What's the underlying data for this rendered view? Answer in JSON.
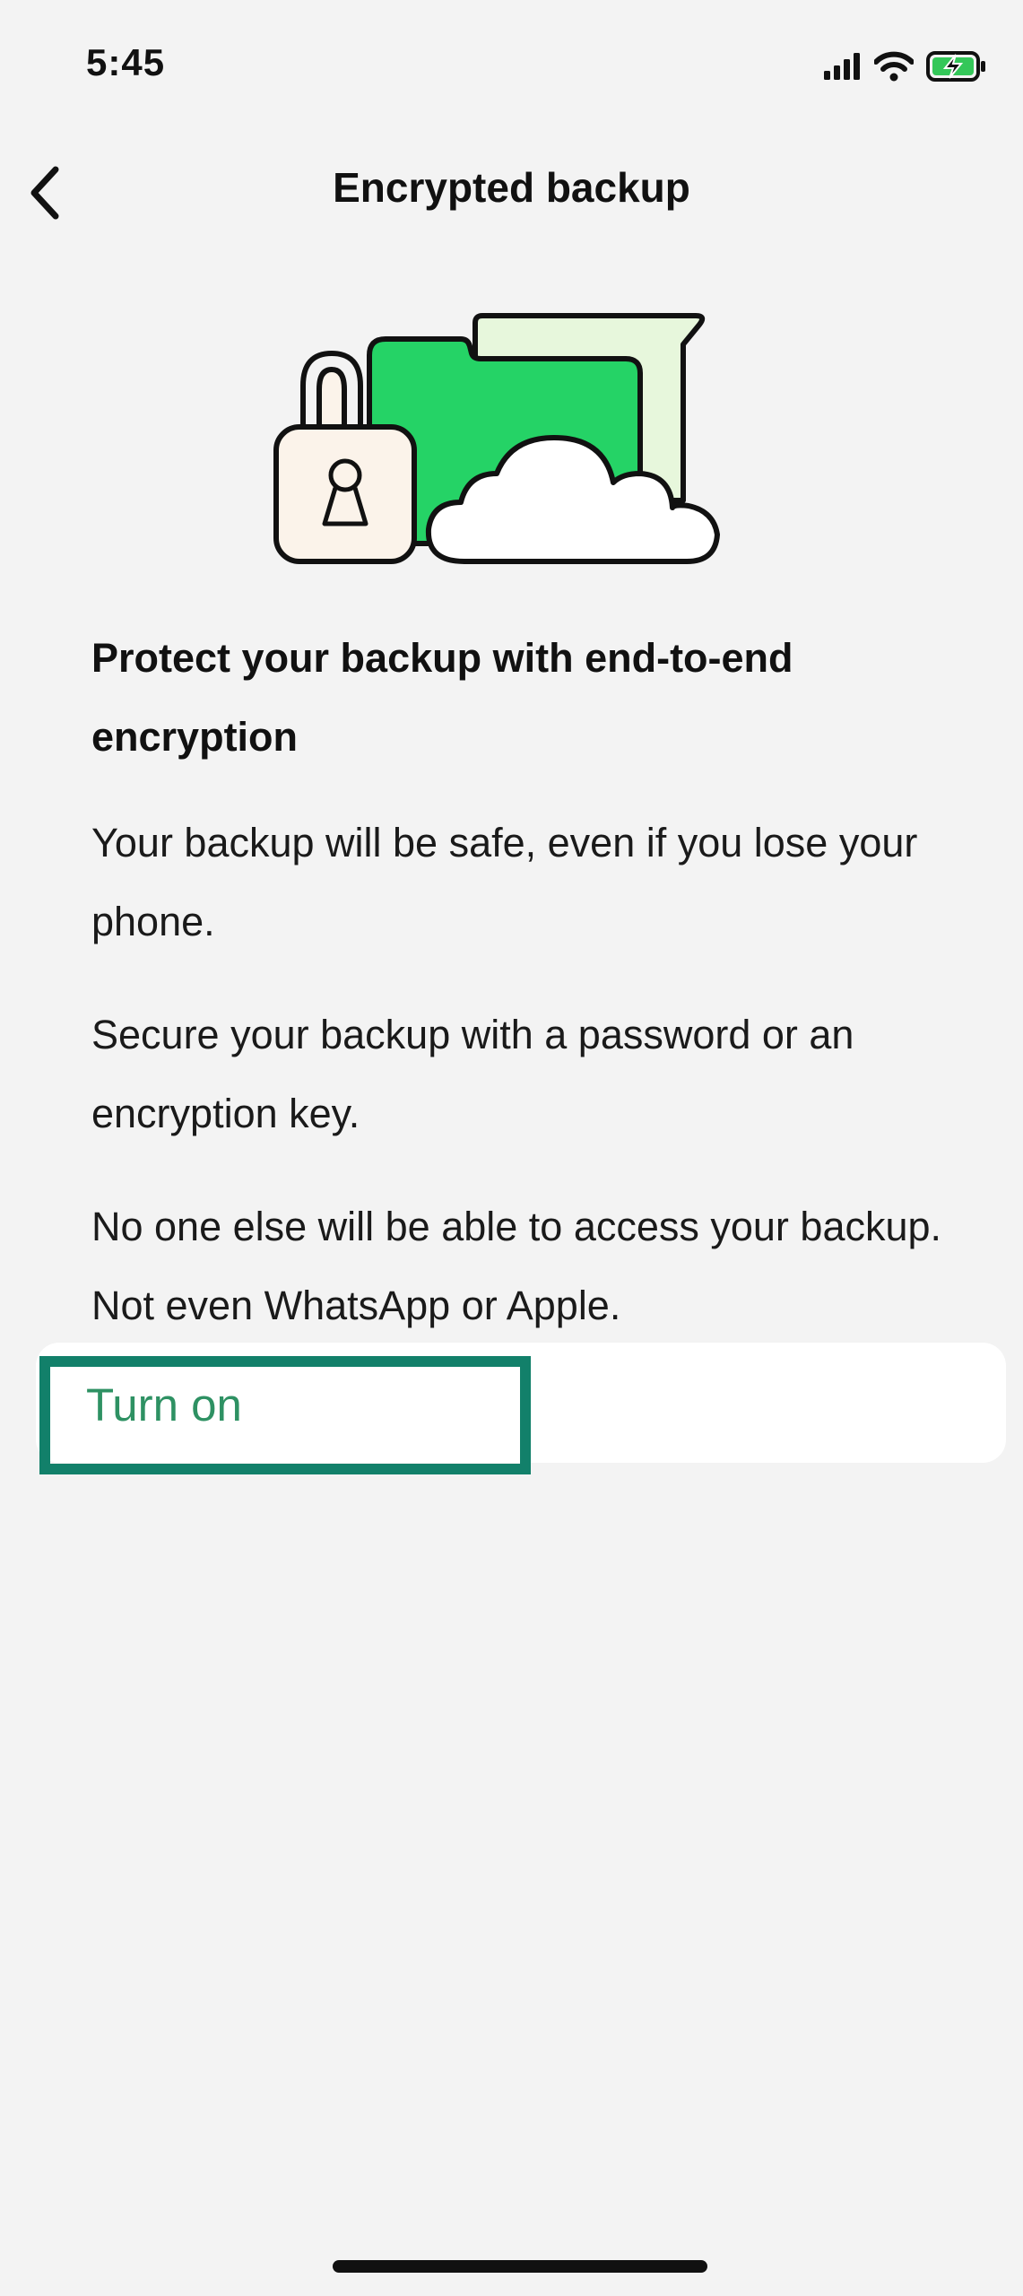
{
  "status_bar": {
    "time": "5:45",
    "icons": [
      "cellular-signal-icon",
      "wifi-icon",
      "battery-charging-icon"
    ],
    "battery_color": "#34c759"
  },
  "nav": {
    "back_icon": "chevron-left-icon",
    "title": "Encrypted backup"
  },
  "illustration": {
    "icons": [
      "padlock-icon",
      "folder-icon",
      "cloud-icon"
    ],
    "colors": {
      "folder_green": "#25d366",
      "folder_back": "#e7f7dc",
      "lock_fill": "#fbf3ea",
      "outline": "#111111"
    }
  },
  "main": {
    "headline": "Protect your backup with end-to-end encryption",
    "paragraphs": [
      "Your backup will be safe, even if you lose your phone.",
      "Secure your backup with a password or an encryption key.",
      "No one else will be able to access your backup. Not even WhatsApp or Apple."
    ],
    "action": {
      "label": "Turn on",
      "color": "#2e9163"
    }
  },
  "highlight": {
    "color": "#12806a",
    "target": "Turn on"
  }
}
